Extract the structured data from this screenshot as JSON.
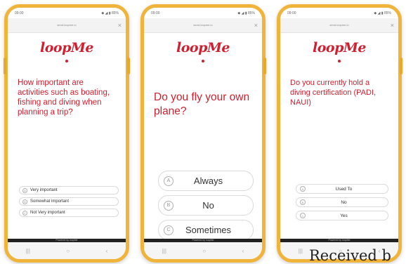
{
  "status": {
    "time": "09:00",
    "battery": "◆ ◢ ▮ 85%"
  },
  "urlbar": {
    "text": "send.loopme.io",
    "close": "×"
  },
  "brand": {
    "logo": "loopMe",
    "color": "#d0202f",
    "frame_color": "#f0b43a"
  },
  "screens": [
    {
      "question": "How important are activities such as boating, fishing and diving when planning a trip?",
      "options": [
        {
          "letter": "A",
          "label": "Very important"
        },
        {
          "letter": "B",
          "label": "Somewhat important"
        },
        {
          "letter": "C",
          "label": "Not Very important"
        }
      ]
    },
    {
      "question": "Do you fly your own plane?",
      "options": [
        {
          "letter": "A",
          "label": "Always"
        },
        {
          "letter": "B",
          "label": "No"
        },
        {
          "letter": "C",
          "label": "Sometimes"
        }
      ]
    },
    {
      "question": "Do you currently hold a diving certification (PADI, NAUI)",
      "options": [
        {
          "letter": "A",
          "label": "Used To"
        },
        {
          "letter": "B",
          "label": "No"
        },
        {
          "letter": "C",
          "label": "Yes"
        }
      ]
    }
  ],
  "footer": {
    "powered": "Powered by loopMe"
  },
  "nav": {
    "recents": "|||",
    "home": "○",
    "back": "‹"
  },
  "watermark": "Received b"
}
